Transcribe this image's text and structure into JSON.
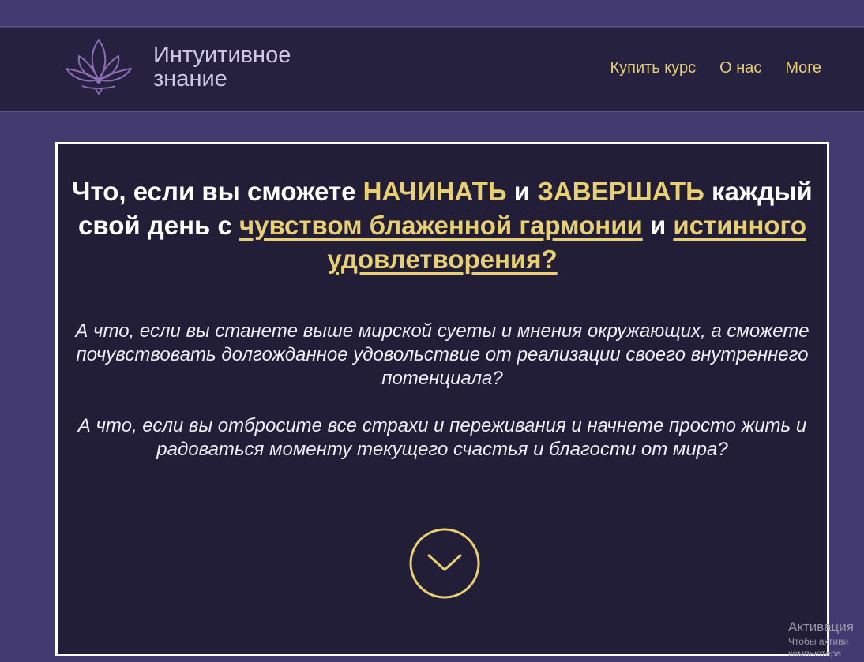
{
  "site": {
    "brand_line1": "Интуитивное",
    "brand_line2": "знание",
    "logo_icon": "lotus-icon"
  },
  "nav": {
    "items": [
      {
        "label": "Купить курс"
      },
      {
        "label": "О нас"
      },
      {
        "label": "More"
      }
    ]
  },
  "hero": {
    "headline": {
      "part1": "Что, если вы сможете ",
      "highlight1": "НАЧИНАТЬ",
      "part2": " и ",
      "highlight2": "ЗАВЕРШАТЬ",
      "part3": " каждый свой день с ",
      "link1": "чувством блаженной гармонии",
      "part4": " и ",
      "link2": "истинного удовлетворения?"
    },
    "paragraph1": "А что, если вы станете выше мирской суеты и мнения окружающих, а сможете почувствовать долгожданное удовольствие от реализации своего внутреннего потенциала?",
    "paragraph2": "А что, если вы отбросите все страхи и переживания и начнете просто жить и радоваться моменту текущего счастья и благости от мира?",
    "scroll_icon": "chevron-down-circle-icon"
  },
  "watermark": {
    "title": "Активация",
    "line1": "Чтобы активи",
    "line2": "компьютера"
  },
  "colors": {
    "background": "#433a6f",
    "header": "#25213f",
    "panel": "#221e38",
    "accent_gold": "#e8cf72",
    "logo_purple": "#8d6db8"
  }
}
